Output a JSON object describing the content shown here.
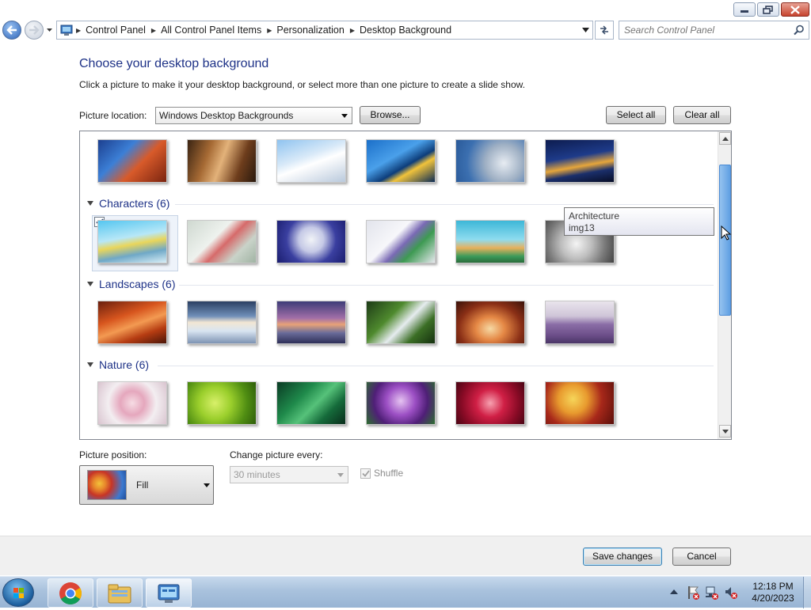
{
  "address_bar": {
    "breadcrumbs": [
      "Control Panel",
      "All Control Panel Items",
      "Personalization",
      "Desktop Background"
    ],
    "search_placeholder": "Search Control Panel"
  },
  "page": {
    "heading": "Choose your desktop background",
    "description": "Click a picture to make it your desktop background, or select more than one picture to create a slide show.",
    "picture_location_label": "Picture location:",
    "picture_location_value": "Windows Desktop Backgrounds",
    "browse_label": "Browse...",
    "select_all_label": "Select all",
    "clear_all_label": "Clear all"
  },
  "gallery": {
    "groups": [
      {
        "title": "Characters (6)"
      },
      {
        "title": "Landscapes (6)"
      },
      {
        "title": "Nature (6)"
      }
    ],
    "tooltip": {
      "line1": "Architecture",
      "line2": "img13"
    },
    "selected_thumbnail": "Characters 1"
  },
  "options": {
    "picture_position_label": "Picture position:",
    "picture_position_value": "Fill",
    "change_picture_label": "Change picture every:",
    "change_picture_value": "30 minutes",
    "shuffle_label": "Shuffle",
    "shuffle_checked": true
  },
  "footer": {
    "save_label": "Save changes",
    "cancel_label": "Cancel"
  },
  "taskbar": {
    "time": "12:18 PM",
    "date": "4/20/2023"
  }
}
